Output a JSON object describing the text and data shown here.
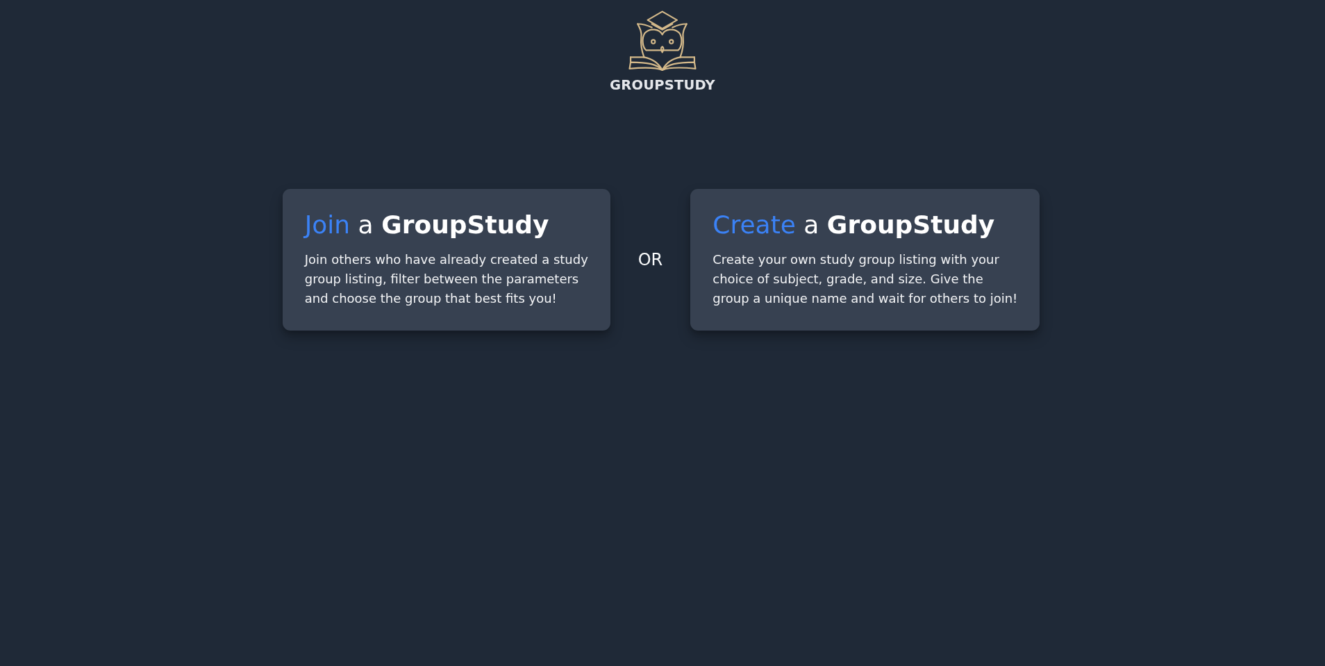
{
  "brand": {
    "name": "GROUPSTUDY"
  },
  "options": [
    {
      "title": {
        "highlight": "Join",
        "rest": "a **GroupStudy**"
      },
      "description": "Join others who have already created a study group listing, filter between the parameters and choose the group that best fits you!"
    },
    {
      "title": {
        "highlight": "Create",
        "rest": "a **GroupStudy**"
      },
      "description": "Create your own study group listing with your choice of subject, grade, and size. Give the group a unique name and wait for others to join!"
    }
  ],
  "separator": "OR"
}
